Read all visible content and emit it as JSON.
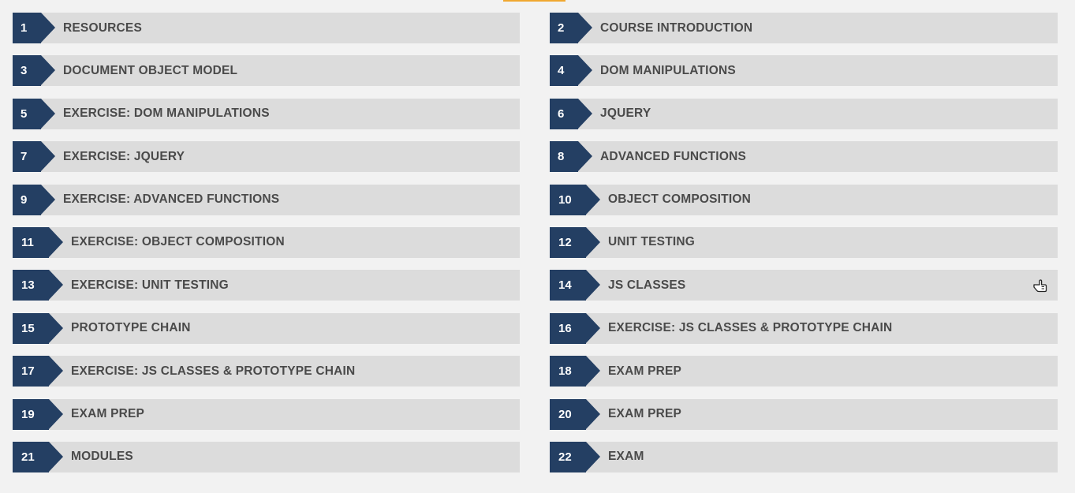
{
  "colors": {
    "background": "#f2f2f2",
    "item_background": "#dcdcdc",
    "badge": "#243f63",
    "label_text": "#4a4a4a",
    "accent": "#f0a830"
  },
  "items": [
    {
      "number": "1",
      "label": "RESOURCES"
    },
    {
      "number": "2",
      "label": "COURSE INTRODUCTION"
    },
    {
      "number": "3",
      "label": "DOCUMENT OBJECT MODEL"
    },
    {
      "number": "4",
      "label": "DOM MANIPULATIONS"
    },
    {
      "number": "5",
      "label": "EXERCISE: DOM MANIPULATIONS"
    },
    {
      "number": "6",
      "label": "JQUERY"
    },
    {
      "number": "7",
      "label": "EXERCISE: JQUERY"
    },
    {
      "number": "8",
      "label": "ADVANCED FUNCTIONS"
    },
    {
      "number": "9",
      "label": "EXERCISE: ADVANCED FUNCTIONS"
    },
    {
      "number": "10",
      "label": "OBJECT COMPOSITION"
    },
    {
      "number": "11",
      "label": "EXERCISE: OBJECT COMPOSITION"
    },
    {
      "number": "12",
      "label": "UNIT TESTING"
    },
    {
      "number": "13",
      "label": "EXERCISE: UNIT TESTING"
    },
    {
      "number": "14",
      "label": "JS CLASSES"
    },
    {
      "number": "15",
      "label": "PROTOTYPE CHAIN"
    },
    {
      "number": "16",
      "label": "EXERCISE: JS CLASSES & PROTOTYPE CHAIN"
    },
    {
      "number": "17",
      "label": "EXERCISE: JS CLASSES & PROTOTYPE CHAIN"
    },
    {
      "number": "18",
      "label": "EXAM PREP"
    },
    {
      "number": "19",
      "label": "EXAM PREP"
    },
    {
      "number": "20",
      "label": "EXAM PREP"
    },
    {
      "number": "21",
      "label": "MODULES"
    },
    {
      "number": "22",
      "label": "EXAM"
    }
  ],
  "cursor": {
    "icon": "pointer-hand-icon",
    "on_item": "14"
  }
}
